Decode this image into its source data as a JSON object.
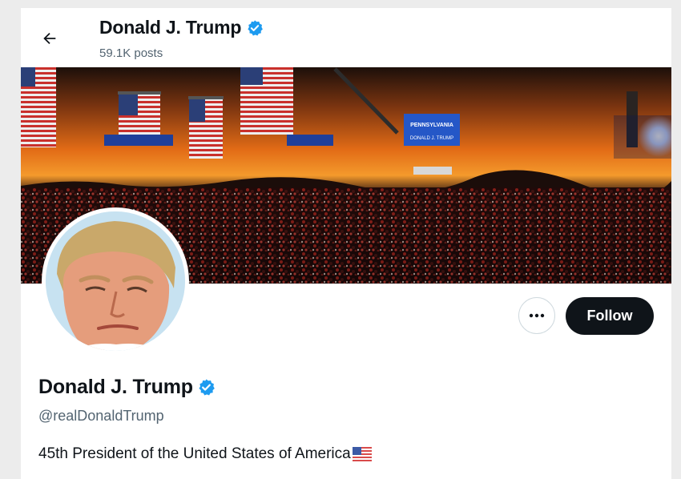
{
  "header": {
    "name": "Donald J. Trump",
    "posts": "59.1K posts"
  },
  "profile": {
    "display_name": "Donald J. Trump",
    "handle": "@realDonaldTrump",
    "bio": "45th President of the United States of America",
    "verified": true
  },
  "actions": {
    "follow_label": "Follow",
    "more_label": "···"
  },
  "banner": {
    "sign_text_1": "PENNSYLVANIA",
    "sign_text_2": "DONALD J. TRUMP"
  },
  "colors": {
    "verified_badge": "#1d9bf0",
    "follow_bg": "#0f1419",
    "secondary_text": "#536471",
    "border": "#cfd9de"
  },
  "icons": {
    "back": "arrow-left-icon",
    "verified": "verified-badge-icon",
    "more": "more-dots-icon",
    "flag": "us-flag-emoji-icon"
  }
}
